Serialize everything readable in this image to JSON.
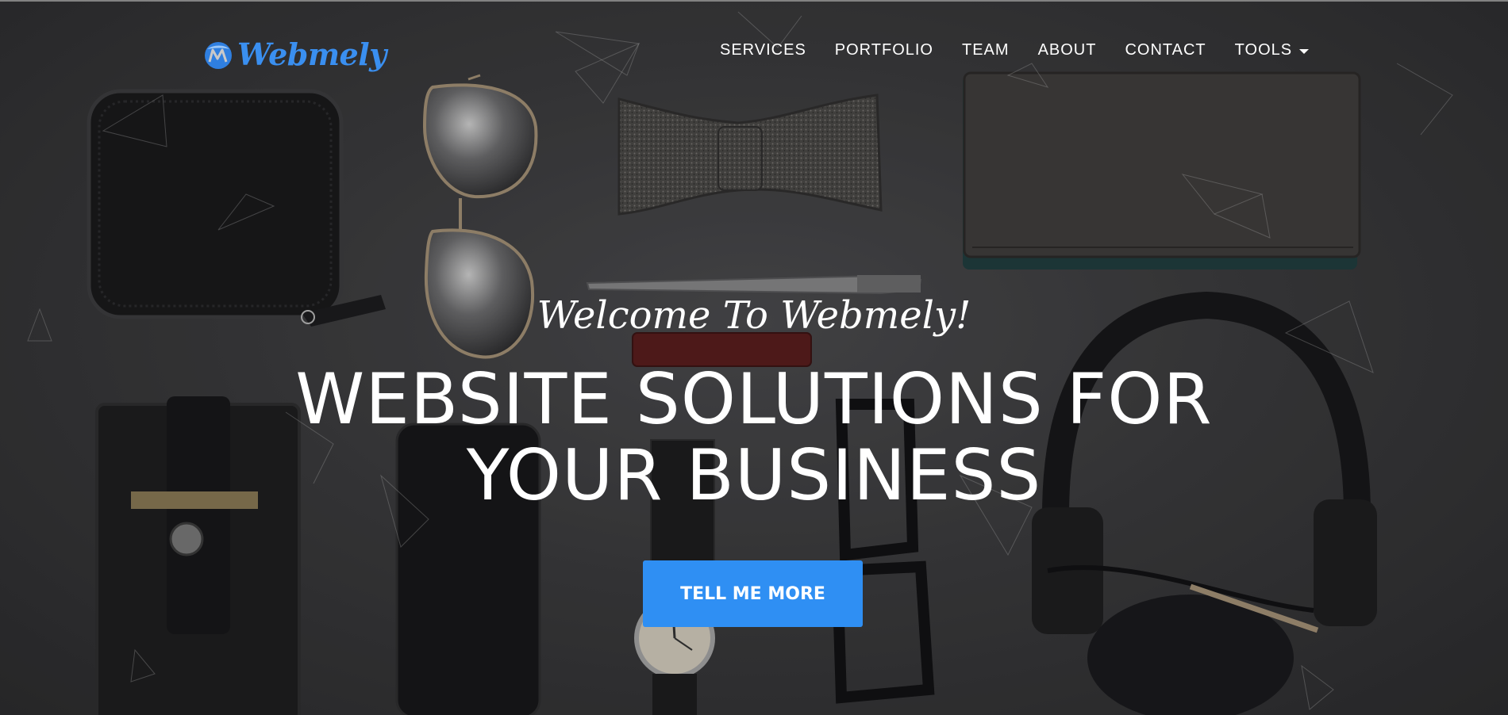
{
  "brand": {
    "name": "Webmely",
    "logo_icon": "webmely-logo-icon",
    "color": "#3a8ff0"
  },
  "nav": {
    "items": [
      {
        "label": "SERVICES"
      },
      {
        "label": "PORTFOLIO"
      },
      {
        "label": "TEAM"
      },
      {
        "label": "ABOUT"
      },
      {
        "label": "CONTACT"
      }
    ],
    "tools_label": "TOOLS",
    "tools_icon": "caret-down-icon"
  },
  "hero": {
    "welcome": "Welcome To Webmely!",
    "headline_line1": "WEBSITE SOLUTIONS FOR",
    "headline_line2": "YOUR BUSINESS",
    "cta_label": "TELL ME MORE",
    "cta_color": "#2f8ff3"
  }
}
